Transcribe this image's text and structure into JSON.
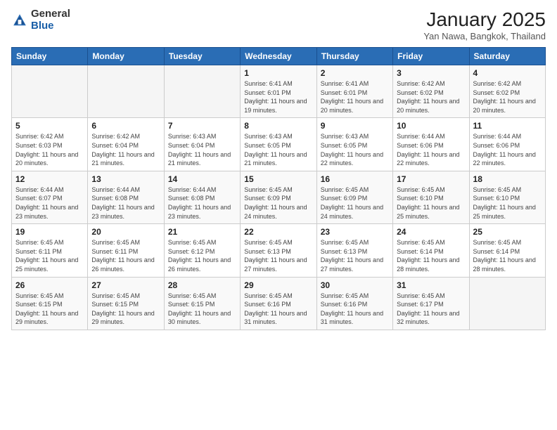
{
  "logo": {
    "general": "General",
    "blue": "Blue"
  },
  "title": {
    "month": "January 2025",
    "location": "Yan Nawa, Bangkok, Thailand"
  },
  "weekdays": [
    "Sunday",
    "Monday",
    "Tuesday",
    "Wednesday",
    "Thursday",
    "Friday",
    "Saturday"
  ],
  "weeks": [
    [
      {
        "day": "",
        "detail": ""
      },
      {
        "day": "",
        "detail": ""
      },
      {
        "day": "",
        "detail": ""
      },
      {
        "day": "1",
        "detail": "Sunrise: 6:41 AM\nSunset: 6:01 PM\nDaylight: 11 hours and 19 minutes."
      },
      {
        "day": "2",
        "detail": "Sunrise: 6:41 AM\nSunset: 6:01 PM\nDaylight: 11 hours and 20 minutes."
      },
      {
        "day": "3",
        "detail": "Sunrise: 6:42 AM\nSunset: 6:02 PM\nDaylight: 11 hours and 20 minutes."
      },
      {
        "day": "4",
        "detail": "Sunrise: 6:42 AM\nSunset: 6:02 PM\nDaylight: 11 hours and 20 minutes."
      }
    ],
    [
      {
        "day": "5",
        "detail": "Sunrise: 6:42 AM\nSunset: 6:03 PM\nDaylight: 11 hours and 20 minutes."
      },
      {
        "day": "6",
        "detail": "Sunrise: 6:42 AM\nSunset: 6:04 PM\nDaylight: 11 hours and 21 minutes."
      },
      {
        "day": "7",
        "detail": "Sunrise: 6:43 AM\nSunset: 6:04 PM\nDaylight: 11 hours and 21 minutes."
      },
      {
        "day": "8",
        "detail": "Sunrise: 6:43 AM\nSunset: 6:05 PM\nDaylight: 11 hours and 21 minutes."
      },
      {
        "day": "9",
        "detail": "Sunrise: 6:43 AM\nSunset: 6:05 PM\nDaylight: 11 hours and 22 minutes."
      },
      {
        "day": "10",
        "detail": "Sunrise: 6:44 AM\nSunset: 6:06 PM\nDaylight: 11 hours and 22 minutes."
      },
      {
        "day": "11",
        "detail": "Sunrise: 6:44 AM\nSunset: 6:06 PM\nDaylight: 11 hours and 22 minutes."
      }
    ],
    [
      {
        "day": "12",
        "detail": "Sunrise: 6:44 AM\nSunset: 6:07 PM\nDaylight: 11 hours and 23 minutes."
      },
      {
        "day": "13",
        "detail": "Sunrise: 6:44 AM\nSunset: 6:08 PM\nDaylight: 11 hours and 23 minutes."
      },
      {
        "day": "14",
        "detail": "Sunrise: 6:44 AM\nSunset: 6:08 PM\nDaylight: 11 hours and 23 minutes."
      },
      {
        "day": "15",
        "detail": "Sunrise: 6:45 AM\nSunset: 6:09 PM\nDaylight: 11 hours and 24 minutes."
      },
      {
        "day": "16",
        "detail": "Sunrise: 6:45 AM\nSunset: 6:09 PM\nDaylight: 11 hours and 24 minutes."
      },
      {
        "day": "17",
        "detail": "Sunrise: 6:45 AM\nSunset: 6:10 PM\nDaylight: 11 hours and 25 minutes."
      },
      {
        "day": "18",
        "detail": "Sunrise: 6:45 AM\nSunset: 6:10 PM\nDaylight: 11 hours and 25 minutes."
      }
    ],
    [
      {
        "day": "19",
        "detail": "Sunrise: 6:45 AM\nSunset: 6:11 PM\nDaylight: 11 hours and 25 minutes."
      },
      {
        "day": "20",
        "detail": "Sunrise: 6:45 AM\nSunset: 6:11 PM\nDaylight: 11 hours and 26 minutes."
      },
      {
        "day": "21",
        "detail": "Sunrise: 6:45 AM\nSunset: 6:12 PM\nDaylight: 11 hours and 26 minutes."
      },
      {
        "day": "22",
        "detail": "Sunrise: 6:45 AM\nSunset: 6:13 PM\nDaylight: 11 hours and 27 minutes."
      },
      {
        "day": "23",
        "detail": "Sunrise: 6:45 AM\nSunset: 6:13 PM\nDaylight: 11 hours and 27 minutes."
      },
      {
        "day": "24",
        "detail": "Sunrise: 6:45 AM\nSunset: 6:14 PM\nDaylight: 11 hours and 28 minutes."
      },
      {
        "day": "25",
        "detail": "Sunrise: 6:45 AM\nSunset: 6:14 PM\nDaylight: 11 hours and 28 minutes."
      }
    ],
    [
      {
        "day": "26",
        "detail": "Sunrise: 6:45 AM\nSunset: 6:15 PM\nDaylight: 11 hours and 29 minutes."
      },
      {
        "day": "27",
        "detail": "Sunrise: 6:45 AM\nSunset: 6:15 PM\nDaylight: 11 hours and 29 minutes."
      },
      {
        "day": "28",
        "detail": "Sunrise: 6:45 AM\nSunset: 6:15 PM\nDaylight: 11 hours and 30 minutes."
      },
      {
        "day": "29",
        "detail": "Sunrise: 6:45 AM\nSunset: 6:16 PM\nDaylight: 11 hours and 31 minutes."
      },
      {
        "day": "30",
        "detail": "Sunrise: 6:45 AM\nSunset: 6:16 PM\nDaylight: 11 hours and 31 minutes."
      },
      {
        "day": "31",
        "detail": "Sunrise: 6:45 AM\nSunset: 6:17 PM\nDaylight: 11 hours and 32 minutes."
      },
      {
        "day": "",
        "detail": ""
      }
    ]
  ]
}
